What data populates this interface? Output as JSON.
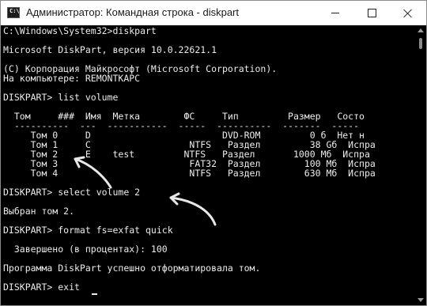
{
  "window": {
    "title": "Администратор: Командная строка - diskpart",
    "icon_text": "C:\\"
  },
  "console": {
    "lines": [
      "C:\\Windows\\System32>diskpart",
      "",
      "Microsoft DiskPart, версия 10.0.22621.1",
      "",
      "(C) Корпорация Майкрософт (Microsoft Corporation).",
      "На компьютере: REMONTKAPC",
      "",
      "DISKPART> list volume",
      "",
      "  Том     ###  Имя  Метка        ФС     Тип         Размер   Состо",
      "  ----------  ---  -----------  -----  ----------  -------  -----",
      "     Том 0     D                        DVD-ROM         0 б  Нет н",
      "     Том 1     C                  NTFS   Раздел         38 Gб  Испра",
      "     Том 2     E    test         NTFS   Раздел       1000 Мб  Испра",
      "     Том 3                        FAT32  Раздел        100 Мб  Испра",
      "     Том 4                        NTFS   Раздел        630 Мб  Испра",
      "",
      "DISKPART> select volume 2",
      "",
      "Выбран том 2.",
      "",
      "DISKPART> format fs=exfat quick",
      "",
      "  Завершено (в процентах): 100",
      "",
      "Программа DiskPart успешно отформатировала том.",
      "",
      "DISKPART> exit"
    ]
  }
}
